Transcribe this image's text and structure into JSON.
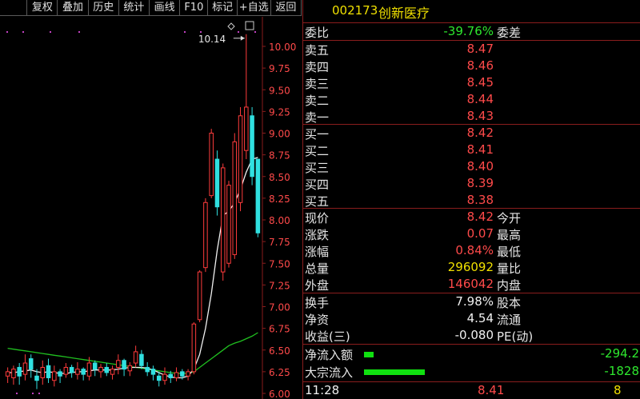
{
  "toolbar": {
    "buttons": [
      {
        "label": "",
        "w": 0
      },
      {
        "label": "复权"
      },
      {
        "label": "叠加"
      },
      {
        "label": "历史"
      },
      {
        "label": "统计"
      },
      {
        "label": "画线"
      },
      {
        "label": "F10"
      },
      {
        "label": "标记"
      },
      {
        "label": "+自选"
      },
      {
        "label": "返回"
      }
    ]
  },
  "stock": {
    "code": "002173",
    "name": "创新医疗"
  },
  "weibi": {
    "label": "委比",
    "value": "-39.76%",
    "label2": "委差"
  },
  "sell": [
    {
      "label": "卖五",
      "price": "8.47"
    },
    {
      "label": "卖四",
      "price": "8.46"
    },
    {
      "label": "卖三",
      "price": "8.45"
    },
    {
      "label": "卖二",
      "price": "8.44"
    },
    {
      "label": "卖一",
      "price": "8.43"
    }
  ],
  "buy": [
    {
      "label": "买一",
      "price": "8.42"
    },
    {
      "label": "买二",
      "price": "8.41"
    },
    {
      "label": "买三",
      "price": "8.40"
    },
    {
      "label": "买四",
      "price": "8.39"
    },
    {
      "label": "买五",
      "price": "8.38"
    }
  ],
  "quote": [
    {
      "label": "现价",
      "value": "8.42",
      "label2": "今开"
    },
    {
      "label": "涨跌",
      "value": "0.07",
      "label2": "最高"
    },
    {
      "label": "涨幅",
      "value": "0.84%",
      "label2": "最低"
    },
    {
      "label": "总量",
      "value": "296092",
      "label2": "量比"
    },
    {
      "label": "外盘",
      "value": "146042",
      "label2": "内盘"
    }
  ],
  "fund": [
    {
      "label": "换手",
      "value": "7.98%",
      "label2": "股本"
    },
    {
      "label": "净资",
      "value": "4.54",
      "label2": "流通"
    },
    {
      "label": "收益(三)",
      "value": "-0.080",
      "label2": "PE(动)"
    }
  ],
  "flow": [
    {
      "label": "净流入额",
      "value": "-294.2",
      "level": 0.16
    },
    {
      "label": "大宗流入",
      "value": "-1828",
      "level": 1.0
    }
  ],
  "bottom": {
    "time": "11:28",
    "price": "8.41",
    "vol": "8"
  },
  "chart_data": {
    "type": "candlestick",
    "y_ticks": [
      "10.00",
      "9.75",
      "9.50",
      "9.25",
      "9.00",
      "8.75",
      "8.50",
      "8.25",
      "8.00",
      "7.75",
      "7.50",
      "7.25",
      "7.00",
      "6.75",
      "6.50",
      "6.25",
      "6.00"
    ],
    "ylim": [
      6.0,
      10.0
    ],
    "high_annotation": "10.14",
    "candles": [
      {
        "o": 6.2,
        "c": 6.25,
        "h": 6.3,
        "l": 6.12
      },
      {
        "o": 6.18,
        "c": 6.28,
        "h": 6.32,
        "l": 6.1
      },
      {
        "o": 6.3,
        "c": 6.2,
        "h": 6.35,
        "l": 6.1
      },
      {
        "o": 6.22,
        "c": 6.35,
        "h": 6.45,
        "l": 6.15
      },
      {
        "o": 6.4,
        "c": 6.28,
        "h": 6.45,
        "l": 6.18
      },
      {
        "o": 6.2,
        "c": 6.15,
        "h": 6.28,
        "l": 6.05
      },
      {
        "o": 6.18,
        "c": 6.3,
        "h": 6.38,
        "l": 6.1
      },
      {
        "o": 6.32,
        "c": 6.18,
        "h": 6.4,
        "l": 6.12
      },
      {
        "o": 6.15,
        "c": 6.25,
        "h": 6.32,
        "l": 6.08
      },
      {
        "o": 6.25,
        "c": 6.2,
        "h": 6.28,
        "l": 6.12
      },
      {
        "o": 6.22,
        "c": 6.3,
        "h": 6.35,
        "l": 6.18
      },
      {
        "o": 6.3,
        "c": 6.24,
        "h": 6.33,
        "l": 6.18
      },
      {
        "o": 6.22,
        "c": 6.28,
        "h": 6.36,
        "l": 6.16
      },
      {
        "o": 6.28,
        "c": 6.22,
        "h": 6.3,
        "l": 6.15
      },
      {
        "o": 6.2,
        "c": 6.35,
        "h": 6.42,
        "l": 6.15
      },
      {
        "o": 6.35,
        "c": 6.28,
        "h": 6.38,
        "l": 6.2
      },
      {
        "o": 6.25,
        "c": 6.3,
        "h": 6.34,
        "l": 6.18
      },
      {
        "o": 6.3,
        "c": 6.24,
        "h": 6.35,
        "l": 6.2
      },
      {
        "o": 6.22,
        "c": 6.28,
        "h": 6.32,
        "l": 6.16
      },
      {
        "o": 6.3,
        "c": 6.38,
        "h": 6.45,
        "l": 6.22
      },
      {
        "o": 6.38,
        "c": 6.28,
        "h": 6.4,
        "l": 6.2
      },
      {
        "o": 6.26,
        "c": 6.32,
        "h": 6.36,
        "l": 6.2
      },
      {
        "o": 6.35,
        "c": 6.48,
        "h": 6.55,
        "l": 6.3
      },
      {
        "o": 6.45,
        "c": 6.32,
        "h": 6.5,
        "l": 6.28
      },
      {
        "o": 6.3,
        "c": 6.25,
        "h": 6.36,
        "l": 6.2
      },
      {
        "o": 6.28,
        "c": 6.22,
        "h": 6.32,
        "l": 6.15
      },
      {
        "o": 6.2,
        "c": 6.15,
        "h": 6.25,
        "l": 6.08
      },
      {
        "o": 6.15,
        "c": 6.22,
        "h": 6.3,
        "l": 6.1
      },
      {
        "o": 6.22,
        "c": 6.18,
        "h": 6.26,
        "l": 6.12
      },
      {
        "o": 6.18,
        "c": 6.24,
        "h": 6.3,
        "l": 6.14
      },
      {
        "o": 6.25,
        "c": 6.2,
        "h": 6.28,
        "l": 6.16
      },
      {
        "o": 6.2,
        "c": 6.25,
        "h": 6.28,
        "l": 6.15
      },
      {
        "o": 6.25,
        "c": 6.8,
        "h": 6.82,
        "l": 6.22
      },
      {
        "o": 6.85,
        "c": 7.4,
        "h": 7.42,
        "l": 6.82
      },
      {
        "o": 7.45,
        "c": 8.2,
        "h": 8.25,
        "l": 7.4
      },
      {
        "o": 8.28,
        "c": 9.0,
        "h": 9.05,
        "l": 8.25
      },
      {
        "o": 8.7,
        "c": 8.15,
        "h": 8.8,
        "l": 8.05
      },
      {
        "o": 7.4,
        "c": 8.6,
        "h": 8.65,
        "l": 7.3
      },
      {
        "o": 7.5,
        "c": 8.4,
        "h": 8.45,
        "l": 7.45
      },
      {
        "o": 7.6,
        "c": 8.9,
        "h": 9.0,
        "l": 7.55
      },
      {
        "o": 8.2,
        "c": 9.2,
        "h": 9.3,
        "l": 8.1
      },
      {
        "o": 8.8,
        "c": 9.3,
        "h": 10.14,
        "l": 8.7
      },
      {
        "o": 9.2,
        "c": 8.5,
        "h": 9.3,
        "l": 8.4
      },
      {
        "o": 8.7,
        "c": 7.85,
        "h": 8.7,
        "l": 7.8
      }
    ],
    "ma_short": [
      6.24,
      6.24,
      6.25,
      6.26,
      6.27,
      6.25,
      6.24,
      6.25,
      6.24,
      6.23,
      6.23,
      6.24,
      6.25,
      6.25,
      6.26,
      6.27,
      6.27,
      6.27,
      6.27,
      6.28,
      6.29,
      6.3,
      6.3,
      6.3,
      6.29,
      6.27,
      6.24,
      6.21,
      6.19,
      6.18,
      6.18,
      6.2,
      6.28,
      6.45,
      6.75,
      7.15,
      7.65,
      8.05,
      8.1,
      8.2,
      8.35,
      8.55,
      8.7,
      8.72
    ],
    "ma_long": [
      6.52,
      6.51,
      6.5,
      6.49,
      6.48,
      6.47,
      6.46,
      6.45,
      6.44,
      6.43,
      6.42,
      6.41,
      6.4,
      6.39,
      6.38,
      6.37,
      6.36,
      6.35,
      6.34,
      6.33,
      6.32,
      6.31,
      6.3,
      6.29,
      6.28,
      6.27,
      6.26,
      6.25,
      6.24,
      6.23,
      6.23,
      6.23,
      6.25,
      6.3,
      6.35,
      6.4,
      6.45,
      6.5,
      6.55,
      6.58,
      6.6,
      6.63,
      6.66,
      6.7
    ]
  }
}
